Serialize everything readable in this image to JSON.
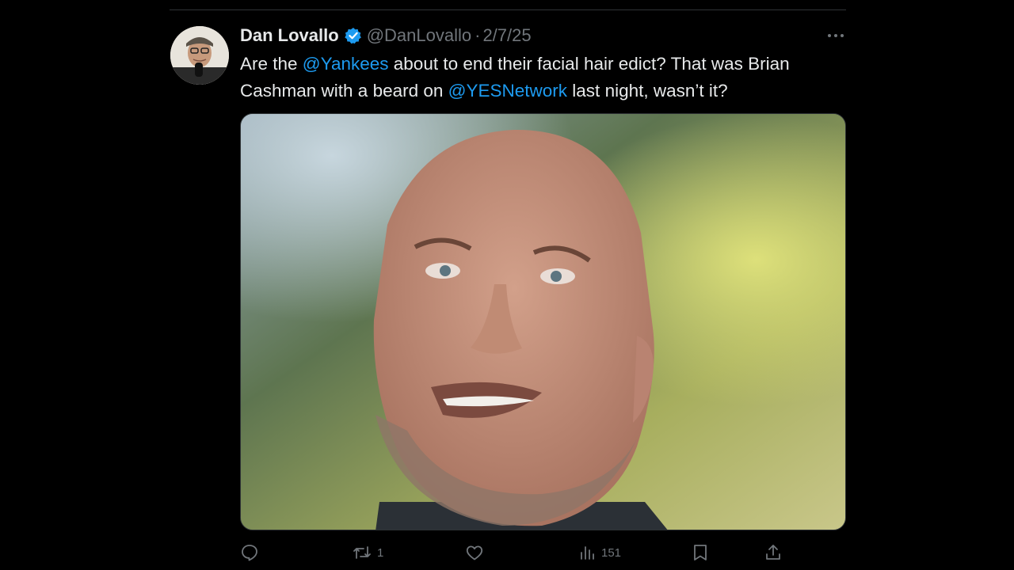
{
  "tweet": {
    "author_name": "Dan Lovallo",
    "handle": "@DanLovallo",
    "separator": "·",
    "date": "2/7/25",
    "text_parts": [
      {
        "text": "Are the ",
        "type": "text"
      },
      {
        "text": "@Yankees",
        "type": "mention"
      },
      {
        "text": " about to end their facial hair edict? That was Brian Cashman with a beard on ",
        "type": "text"
      },
      {
        "text": "@YESNetwork",
        "type": "mention"
      },
      {
        "text": " last night, wasn’t it?",
        "type": "text"
      }
    ],
    "media_icon": "video-photo",
    "verified_icon": "verified-badge-icon",
    "more_icon": "more-dots-icon"
  },
  "actions": {
    "reply": {
      "icon": "reply-icon",
      "count": ""
    },
    "retweet": {
      "icon": "retweet-icon",
      "count": "1"
    },
    "like": {
      "icon": "heart-icon",
      "count": ""
    },
    "views": {
      "icon": "views-icon",
      "count": "151"
    },
    "bookmark": {
      "icon": "bookmark-icon",
      "count": ""
    },
    "share": {
      "icon": "share-icon",
      "count": ""
    }
  },
  "colors": {
    "background": "#000000",
    "text": "#e7e9ea",
    "muted": "#71767b",
    "accent": "#1d9bf0",
    "divider": "#2f3336"
  }
}
